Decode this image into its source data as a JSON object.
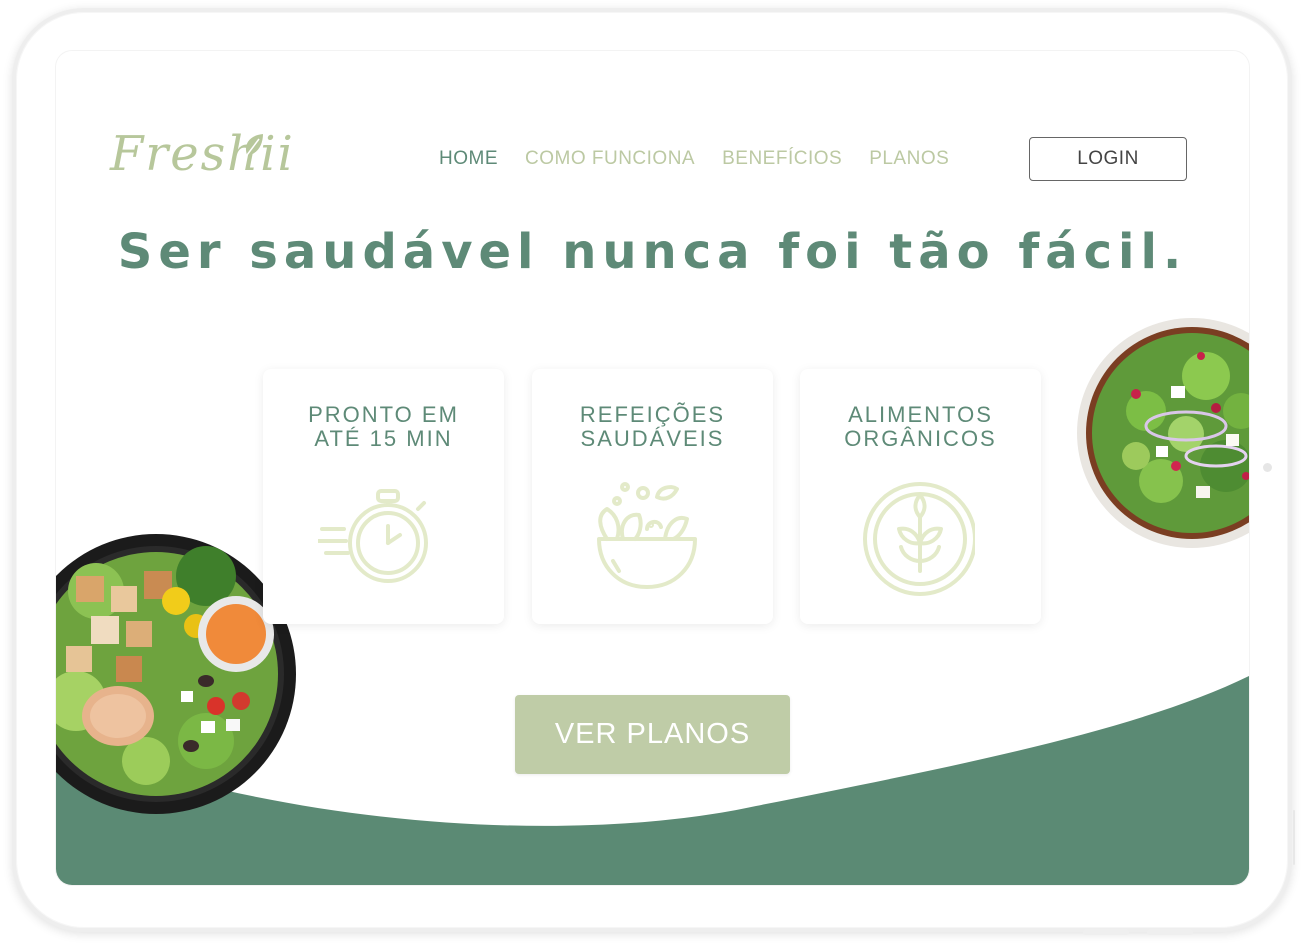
{
  "brand": {
    "logo": "Freshii"
  },
  "nav": {
    "items": [
      {
        "label": "HOME",
        "active": true
      },
      {
        "label": "COMO FUNCIONA",
        "active": false
      },
      {
        "label": "BENEFÍCIOS",
        "active": false
      },
      {
        "label": "PLANOS",
        "active": false
      }
    ],
    "login_label": "LOGIN"
  },
  "hero": {
    "headline": "Ser saudável nunca foi tão fácil.",
    "cta_label": "VER PLANOS"
  },
  "features": [
    {
      "title_line1": "PRONTO EM",
      "title_line2": "ATÉ 15 MIN",
      "icon": "stopwatch-icon"
    },
    {
      "title_line1": "REFEIÇÕES",
      "title_line2": "SAUDÁVEIS",
      "icon": "salad-bowl-icon"
    },
    {
      "title_line1": "ALIMENTOS",
      "title_line2": "ORGÂNICOS",
      "icon": "organic-leaf-icon"
    }
  ],
  "colors": {
    "primary_green": "#5e8a77",
    "light_green": "#bfcca7",
    "icon_green": "#e3eac9"
  }
}
